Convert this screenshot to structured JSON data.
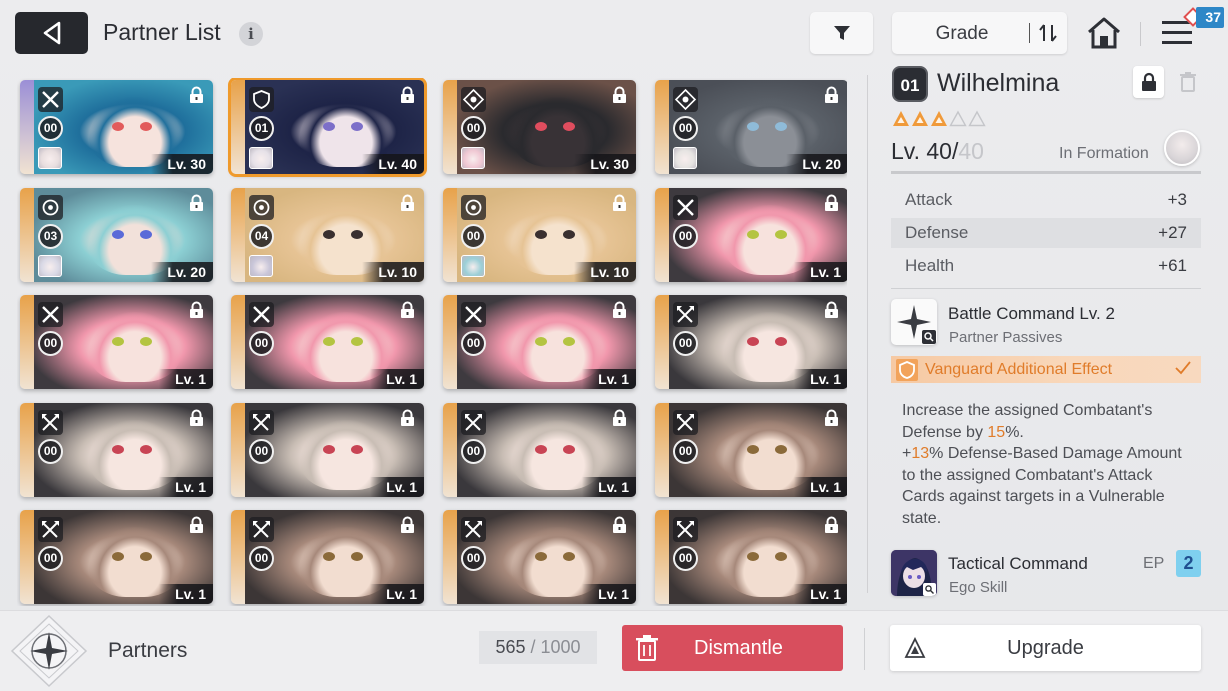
{
  "header": {
    "title": "Partner List",
    "info_icon": "i",
    "grade_label": "Grade",
    "notification_count": "37"
  },
  "icons": {
    "back": "back-arrow-icon",
    "filter": "filter-icon",
    "sort": "sort-icon",
    "home": "home-icon",
    "menu": "menu-icon"
  },
  "cards": [
    {
      "class": "sword",
      "number": "00",
      "level": "Lv. 30",
      "stripe": "#9b8fd6",
      "bg": "#3a9ab8",
      "hair": "#1f6f9c",
      "eyes": "#e25b5b",
      "skin": "#f6e3dd",
      "mini": "#e8dedf",
      "selected": false
    },
    {
      "class": "shield",
      "number": "01",
      "level": "Lv. 40",
      "stripe": "#e8a24a",
      "bg": "#2a3154",
      "hair": "#1e2447",
      "eyes": "#7c6fc9",
      "skin": "#efe4ea",
      "mini": "#e6e1e8",
      "selected": true
    },
    {
      "class": "target",
      "number": "00",
      "level": "Lv. 30",
      "stripe": "#e8a24a",
      "bg": "#6b5148",
      "hair": "#2a2a2e",
      "eyes": "#e04d5e",
      "skin": "#383236",
      "mini": "#f0c8d3",
      "selected": false
    },
    {
      "class": "target",
      "number": "00",
      "level": "Lv. 20",
      "stripe": "#e8a24a",
      "bg": "#4b4f57",
      "hair": "#5a6068",
      "eyes": "#8fbbd8",
      "skin": "#8b8f96",
      "mini": "#e6e4e2",
      "selected": false
    },
    {
      "class": "crosshair",
      "number": "03",
      "level": "Lv. 20",
      "stripe": "#e8a24a",
      "bg": "#5e8c9a",
      "hair": "#8ccfd3",
      "eyes": "#5a6ad8",
      "skin": "#f2e1da",
      "mini": "#d9d9e6",
      "selected": false
    },
    {
      "class": "crosshair",
      "number": "04",
      "level": "Lv. 10",
      "stripe": "#e8a24a",
      "bg": "#d8b680",
      "hair": "#e6c394",
      "eyes": "#3a3030",
      "skin": "#f5e2cd",
      "mini": "#c9c6d9",
      "selected": false
    },
    {
      "class": "crosshair",
      "number": "00",
      "level": "Lv. 10",
      "stripe": "#e8a24a",
      "bg": "#d8b680",
      "hair": "#e6c394",
      "eyes": "#3a3030",
      "skin": "#f5e2cd",
      "mini": "#9bcfd7",
      "selected": false
    },
    {
      "class": "sword",
      "number": "00",
      "level": "Lv. 1",
      "stripe": "#e8a24a",
      "bg": "#3e3a3f",
      "hair": "#f197ac",
      "eyes": "#b4c441",
      "skin": "#f7e2dd",
      "mini": "",
      "selected": false
    },
    {
      "class": "sword",
      "number": "00",
      "level": "Lv. 1",
      "stripe": "#e8a24a",
      "bg": "#3e3a3f",
      "hair": "#f197ac",
      "eyes": "#b4c441",
      "skin": "#f7e2dd",
      "mini": "",
      "selected": false
    },
    {
      "class": "sword",
      "number": "00",
      "level": "Lv. 1",
      "stripe": "#e8a24a",
      "bg": "#3e3a3f",
      "hair": "#f197ac",
      "eyes": "#b4c441",
      "skin": "#f7e2dd",
      "mini": "",
      "selected": false
    },
    {
      "class": "sword",
      "number": "00",
      "level": "Lv. 1",
      "stripe": "#e8a24a",
      "bg": "#3e3a3f",
      "hair": "#f197ac",
      "eyes": "#b4c441",
      "skin": "#f7e2dd",
      "mini": "",
      "selected": false
    },
    {
      "class": "blade",
      "number": "00",
      "level": "Lv. 1",
      "stripe": "#e8a24a",
      "bg": "#3a383c",
      "hair": "#c8bdb4",
      "eyes": "#c84454",
      "skin": "#f6e6e0",
      "mini": "",
      "selected": false
    },
    {
      "class": "blade",
      "number": "00",
      "level": "Lv. 1",
      "stripe": "#e8a24a",
      "bg": "#3a383c",
      "hair": "#c8bdb4",
      "eyes": "#c84454",
      "skin": "#f6e6e0",
      "mini": "",
      "selected": false
    },
    {
      "class": "blade",
      "number": "00",
      "level": "Lv. 1",
      "stripe": "#e8a24a",
      "bg": "#3a383c",
      "hair": "#c8bdb4",
      "eyes": "#c84454",
      "skin": "#f6e6e0",
      "mini": "",
      "selected": false
    },
    {
      "class": "blade",
      "number": "00",
      "level": "Lv. 1",
      "stripe": "#e8a24a",
      "bg": "#3a383c",
      "hair": "#c8bdb4",
      "eyes": "#c84454",
      "skin": "#f6e6e0",
      "mini": "",
      "selected": false
    },
    {
      "class": "blade",
      "number": "00",
      "level": "Lv. 1",
      "stripe": "#e8a24a",
      "bg": "#3c3636",
      "hair": "#a6887a",
      "eyes": "#8b6a3a",
      "skin": "#f2ddd0",
      "mini": "",
      "selected": false
    },
    {
      "class": "blade",
      "number": "00",
      "level": "Lv. 1",
      "stripe": "#e8a24a",
      "bg": "#3c3636",
      "hair": "#a6887a",
      "eyes": "#8b6a3a",
      "skin": "#f2ddd0",
      "mini": "",
      "selected": false
    },
    {
      "class": "blade",
      "number": "00",
      "level": "Lv. 1",
      "stripe": "#e8a24a",
      "bg": "#3c3636",
      "hair": "#a6887a",
      "eyes": "#8b6a3a",
      "skin": "#f2ddd0",
      "mini": "",
      "selected": false
    },
    {
      "class": "blade",
      "number": "00",
      "level": "Lv. 1",
      "stripe": "#e8a24a",
      "bg": "#3c3636",
      "hair": "#a6887a",
      "eyes": "#8b6a3a",
      "skin": "#f2ddd0",
      "mini": "",
      "selected": false
    },
    {
      "class": "blade",
      "number": "00",
      "level": "Lv. 1",
      "stripe": "#e8a24a",
      "bg": "#3c3636",
      "hair": "#a6887a",
      "eyes": "#8b6a3a",
      "skin": "#f2ddd0",
      "mini": "",
      "selected": false
    }
  ],
  "detail": {
    "rank": "01",
    "name": "Wilhelmina",
    "stars_filled": 3,
    "stars_total": 5,
    "level_current": "Lv. 40/",
    "level_max": "40",
    "formation_label": "In Formation",
    "stats": [
      {
        "label": "Attack",
        "value": "+3"
      },
      {
        "label": "Defense",
        "value": "+27"
      },
      {
        "label": "Health",
        "value": "+61"
      }
    ],
    "passive": {
      "title": "Battle Command Lv. 2",
      "subtitle": "Partner Passives",
      "effect_label": "Vanguard Additional Effect",
      "desc_1": "Increase the assigned Combatant's Defense by ",
      "desc_pct_1": "15",
      "desc_2": "%.",
      "desc_3": "+",
      "desc_pct_2": "13",
      "desc_4": "% Defense-Based Damage Amount to the assigned Combatant's Attack Cards against targets in a Vulnerable state."
    },
    "ego": {
      "title": "Tactical Command",
      "subtitle": "Ego Skill",
      "ep_label": "EP",
      "ep_value": "2"
    }
  },
  "footer": {
    "section_label": "Partners",
    "capacity_current": "565",
    "capacity_sep": " / ",
    "capacity_max": "1000",
    "dismantle_label": "Dismantle",
    "upgrade_label": "Upgrade"
  },
  "colors": {
    "accent_orange": "#e07c2a",
    "dismantle_red": "#d84e5d",
    "selected_outline": "#ef9a2c",
    "ep_blue": "#7fd0ef"
  }
}
